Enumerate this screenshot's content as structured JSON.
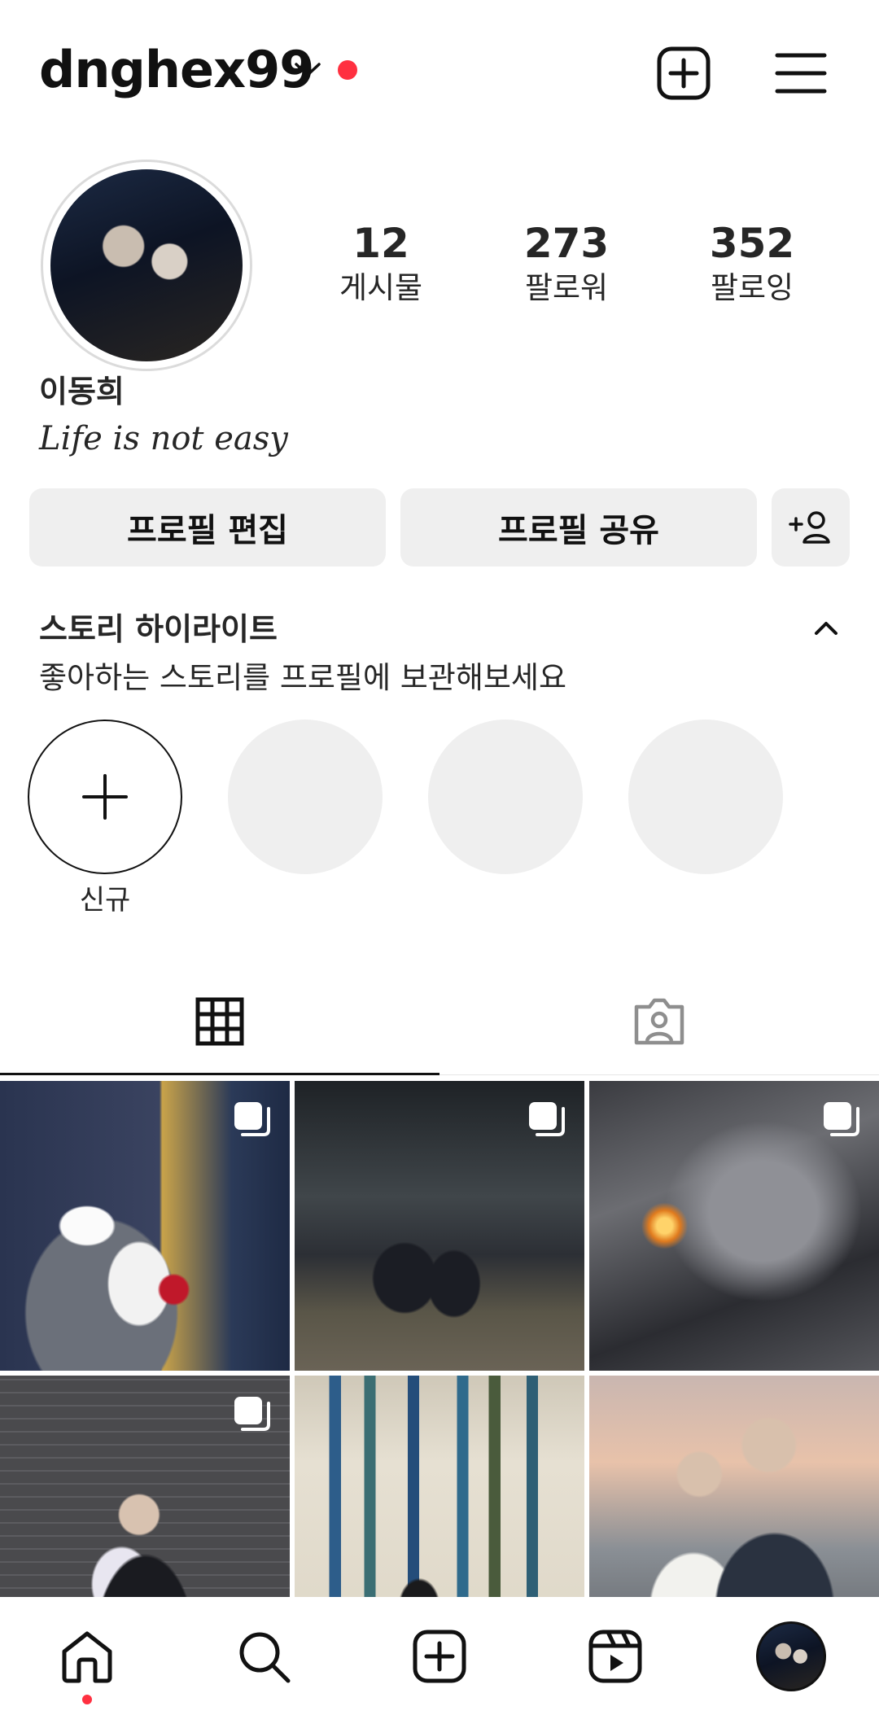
{
  "header": {
    "username": "dnghex99"
  },
  "profile": {
    "stats": [
      {
        "value": "12",
        "label": "게시물"
      },
      {
        "value": "273",
        "label": "팔로워"
      },
      {
        "value": "352",
        "label": "팔로잉"
      }
    ],
    "full_name": "이동희",
    "bio": "Life is not easy"
  },
  "actions": {
    "edit_profile": "프로필 편집",
    "share_profile": "프로필 공유"
  },
  "highlights": {
    "title": "스토리 하이라이트",
    "subtitle": "좋아하는 스토리를 프로필에 보관해보세요",
    "new_label": "신규"
  },
  "colors": {
    "accent_dot": "#ff3040",
    "button_bg": "#efefef",
    "placeholder": "#efefef"
  },
  "icons": {
    "header": [
      "chevron-down-icon",
      "notification-dot",
      "new-post-icon",
      "menu-icon"
    ],
    "tabs": [
      "grid-icon",
      "tagged-icon"
    ],
    "nav": [
      "home-icon",
      "search-icon",
      "create-icon",
      "reels-icon",
      "profile-avatar"
    ]
  }
}
